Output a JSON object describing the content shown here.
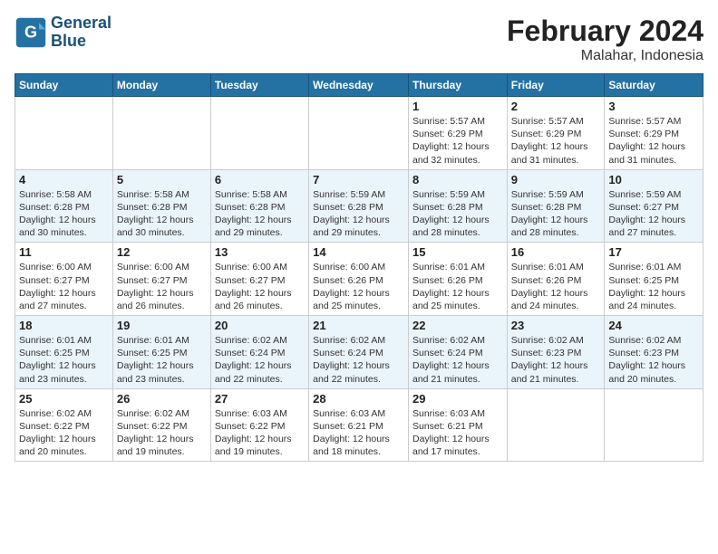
{
  "header": {
    "logo_line1": "General",
    "logo_line2": "Blue",
    "title": "February 2024",
    "subtitle": "Malahar, Indonesia"
  },
  "days_of_week": [
    "Sunday",
    "Monday",
    "Tuesday",
    "Wednesday",
    "Thursday",
    "Friday",
    "Saturday"
  ],
  "weeks": [
    [
      {
        "day": "",
        "info": ""
      },
      {
        "day": "",
        "info": ""
      },
      {
        "day": "",
        "info": ""
      },
      {
        "day": "",
        "info": ""
      },
      {
        "day": "1",
        "info": "Sunrise: 5:57 AM\nSunset: 6:29 PM\nDaylight: 12 hours\nand 32 minutes."
      },
      {
        "day": "2",
        "info": "Sunrise: 5:57 AM\nSunset: 6:29 PM\nDaylight: 12 hours\nand 31 minutes."
      },
      {
        "day": "3",
        "info": "Sunrise: 5:57 AM\nSunset: 6:29 PM\nDaylight: 12 hours\nand 31 minutes."
      }
    ],
    [
      {
        "day": "4",
        "info": "Sunrise: 5:58 AM\nSunset: 6:28 PM\nDaylight: 12 hours\nand 30 minutes."
      },
      {
        "day": "5",
        "info": "Sunrise: 5:58 AM\nSunset: 6:28 PM\nDaylight: 12 hours\nand 30 minutes."
      },
      {
        "day": "6",
        "info": "Sunrise: 5:58 AM\nSunset: 6:28 PM\nDaylight: 12 hours\nand 29 minutes."
      },
      {
        "day": "7",
        "info": "Sunrise: 5:59 AM\nSunset: 6:28 PM\nDaylight: 12 hours\nand 29 minutes."
      },
      {
        "day": "8",
        "info": "Sunrise: 5:59 AM\nSunset: 6:28 PM\nDaylight: 12 hours\nand 28 minutes."
      },
      {
        "day": "9",
        "info": "Sunrise: 5:59 AM\nSunset: 6:28 PM\nDaylight: 12 hours\nand 28 minutes."
      },
      {
        "day": "10",
        "info": "Sunrise: 5:59 AM\nSunset: 6:27 PM\nDaylight: 12 hours\nand 27 minutes."
      }
    ],
    [
      {
        "day": "11",
        "info": "Sunrise: 6:00 AM\nSunset: 6:27 PM\nDaylight: 12 hours\nand 27 minutes."
      },
      {
        "day": "12",
        "info": "Sunrise: 6:00 AM\nSunset: 6:27 PM\nDaylight: 12 hours\nand 26 minutes."
      },
      {
        "day": "13",
        "info": "Sunrise: 6:00 AM\nSunset: 6:27 PM\nDaylight: 12 hours\nand 26 minutes."
      },
      {
        "day": "14",
        "info": "Sunrise: 6:00 AM\nSunset: 6:26 PM\nDaylight: 12 hours\nand 25 minutes."
      },
      {
        "day": "15",
        "info": "Sunrise: 6:01 AM\nSunset: 6:26 PM\nDaylight: 12 hours\nand 25 minutes."
      },
      {
        "day": "16",
        "info": "Sunrise: 6:01 AM\nSunset: 6:26 PM\nDaylight: 12 hours\nand 24 minutes."
      },
      {
        "day": "17",
        "info": "Sunrise: 6:01 AM\nSunset: 6:25 PM\nDaylight: 12 hours\nand 24 minutes."
      }
    ],
    [
      {
        "day": "18",
        "info": "Sunrise: 6:01 AM\nSunset: 6:25 PM\nDaylight: 12 hours\nand 23 minutes."
      },
      {
        "day": "19",
        "info": "Sunrise: 6:01 AM\nSunset: 6:25 PM\nDaylight: 12 hours\nand 23 minutes."
      },
      {
        "day": "20",
        "info": "Sunrise: 6:02 AM\nSunset: 6:24 PM\nDaylight: 12 hours\nand 22 minutes."
      },
      {
        "day": "21",
        "info": "Sunrise: 6:02 AM\nSunset: 6:24 PM\nDaylight: 12 hours\nand 22 minutes."
      },
      {
        "day": "22",
        "info": "Sunrise: 6:02 AM\nSunset: 6:24 PM\nDaylight: 12 hours\nand 21 minutes."
      },
      {
        "day": "23",
        "info": "Sunrise: 6:02 AM\nSunset: 6:23 PM\nDaylight: 12 hours\nand 21 minutes."
      },
      {
        "day": "24",
        "info": "Sunrise: 6:02 AM\nSunset: 6:23 PM\nDaylight: 12 hours\nand 20 minutes."
      }
    ],
    [
      {
        "day": "25",
        "info": "Sunrise: 6:02 AM\nSunset: 6:22 PM\nDaylight: 12 hours\nand 20 minutes."
      },
      {
        "day": "26",
        "info": "Sunrise: 6:02 AM\nSunset: 6:22 PM\nDaylight: 12 hours\nand 19 minutes."
      },
      {
        "day": "27",
        "info": "Sunrise: 6:03 AM\nSunset: 6:22 PM\nDaylight: 12 hours\nand 19 minutes."
      },
      {
        "day": "28",
        "info": "Sunrise: 6:03 AM\nSunset: 6:21 PM\nDaylight: 12 hours\nand 18 minutes."
      },
      {
        "day": "29",
        "info": "Sunrise: 6:03 AM\nSunset: 6:21 PM\nDaylight: 12 hours\nand 17 minutes."
      },
      {
        "day": "",
        "info": ""
      },
      {
        "day": "",
        "info": ""
      }
    ]
  ]
}
